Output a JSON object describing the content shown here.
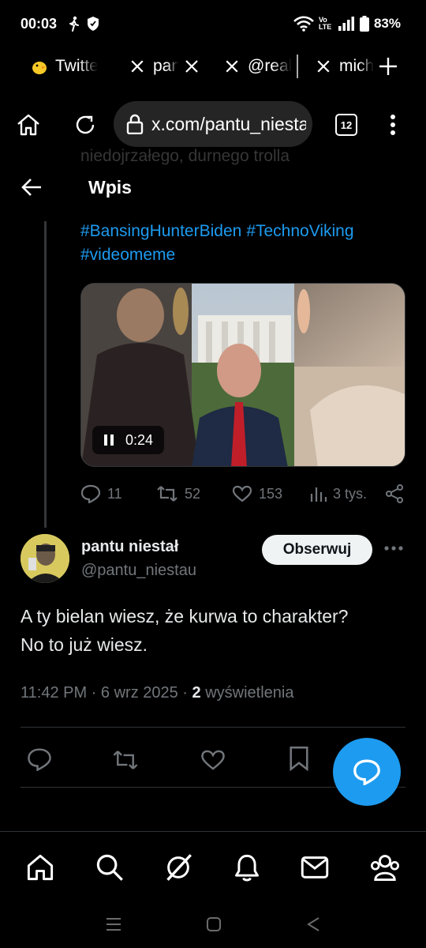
{
  "status_bar": {
    "time": "00:03",
    "network": "Vo LTE",
    "battery": "83%"
  },
  "tabs": [
    {
      "icon": "chick-emoji-icon",
      "title": "Twitter",
      "closable": false
    },
    {
      "icon": "x-logo-icon",
      "title": "pantu",
      "closable": true
    },
    {
      "icon": "x-logo-icon",
      "title": "@real",
      "closable": false
    },
    {
      "icon": "x-logo-icon",
      "title": "micha",
      "closable": false
    }
  ],
  "browser": {
    "url": "x.com/pantu_niestau",
    "tab_count": "12"
  },
  "x_header": {
    "title": "Wpis",
    "ghost_text": "niedojrzałego, durnego trolla"
  },
  "quoted_post": {
    "hashtags": [
      "#BansingHunterBiden",
      "#TechnoViking",
      "#videomeme"
    ],
    "video_time": "0:24",
    "stats": {
      "replies": "11",
      "reposts": "52",
      "likes": "153",
      "views": "3 tys."
    }
  },
  "post": {
    "author_name": "pantu niestał",
    "author_handle": "@pantu_niestau",
    "follow_label": "Obserwuj",
    "text_line1": "A ty bielan wiesz, że kurwa to charakter?",
    "text_line2": "No to już wiesz.",
    "time": "11:42 PM",
    "date": "6 wrz 2025",
    "views_count": "2",
    "views_label": "wyświetlenia"
  },
  "colors": {
    "accent": "#1d9bf0",
    "background": "#000000",
    "secondary_text": "#71767b"
  }
}
